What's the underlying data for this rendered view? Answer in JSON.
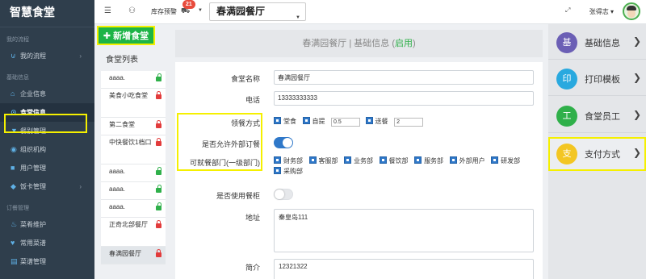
{
  "sidebar": {
    "brand": "智慧食堂",
    "group1_label": "我的流程",
    "group1_items": [
      {
        "label": "我的流程",
        "icon": "magnet-icon",
        "has_chevron": true
      }
    ],
    "group2_label": "基础信息",
    "group2_items": [
      {
        "label": "企业信息",
        "icon": "home-icon",
        "has_chevron": false
      },
      {
        "label": "食堂信息",
        "icon": "location-pin-icon",
        "has_chevron": false,
        "active": true
      },
      {
        "label": "餐别管理",
        "icon": "filter-icon",
        "has_chevron": false
      },
      {
        "label": "组织机构",
        "icon": "org-icon",
        "has_chevron": false
      },
      {
        "label": "用户管理",
        "icon": "user-icon",
        "has_chevron": false
      },
      {
        "label": "饭卡管理",
        "icon": "card-tag-icon",
        "has_chevron": true
      }
    ],
    "group3_label": "订餐管理",
    "group3_items": [
      {
        "label": "菜肴维护",
        "icon": "fire-icon",
        "has_chevron": false
      },
      {
        "label": "常用菜谱",
        "icon": "heart-icon",
        "has_chevron": false
      },
      {
        "label": "菜谱管理",
        "icon": "book-icon",
        "has_chevron": false
      }
    ]
  },
  "topbar": {
    "menu_icon": "☰",
    "user_icon": "⚇",
    "stock_label": "库存预警",
    "stock_badge": "21",
    "canteen_selected": "春满园餐厅",
    "user_name": "张得志"
  },
  "canteen_list": {
    "add_button": "新增食堂",
    "title": "食堂列表",
    "items": [
      {
        "name": "aaaa.",
        "locked": false
      },
      {
        "name": "美食小吃食堂",
        "locked": true
      },
      {
        "name": "第二食堂",
        "locked": true
      },
      {
        "name": "中快餐饮1档口",
        "locked": true
      },
      {
        "name": "aaaa.",
        "locked": false
      },
      {
        "name": "aaaa.",
        "locked": false
      },
      {
        "name": "aaaa.",
        "locked": false
      },
      {
        "name": "正奇北部餐厅",
        "locked": true
      },
      {
        "name": "春满园餐厅",
        "locked": true,
        "active": true
      }
    ]
  },
  "main": {
    "header_title": "春满园餐厅 | 基础信息 (",
    "header_status": "启用",
    "header_close": ")",
    "form": {
      "name_label": "食堂名称",
      "name_value": "春满园餐厅",
      "phone_label": "电话",
      "phone_value": "13333333333",
      "pickup_label": "领餐方式",
      "pickup_dine": "堂食",
      "pickup_self": "自提",
      "pickup_self_value": "0.5",
      "pickup_delivery": "送餐",
      "pickup_delivery_value": "2",
      "external_label": "是否允许外部订餐",
      "external_on": true,
      "depts_label": "可就餐部门(一级部门)",
      "depts": [
        "财务部",
        "客服部",
        "业务部",
        "餐饮部",
        "服务部",
        "外部用户",
        "研发部",
        "采购部"
      ],
      "cabinet_label": "是否使用餐柜",
      "cabinet_on": false,
      "address_label": "地址",
      "address_value": "秦皇岛111",
      "intro_label": "简介",
      "intro_value": "12321322"
    }
  },
  "right_panel": {
    "cards": [
      {
        "char": "基",
        "label": "基础信息",
        "color": "#6b5fb5"
      },
      {
        "char": "印",
        "label": "打印模板",
        "color": "#29a9df"
      },
      {
        "char": "工",
        "label": "食堂员工",
        "color": "#2fb04a"
      },
      {
        "char": "支",
        "label": "支付方式",
        "color": "#f3c623",
        "highlighted": true
      }
    ]
  }
}
